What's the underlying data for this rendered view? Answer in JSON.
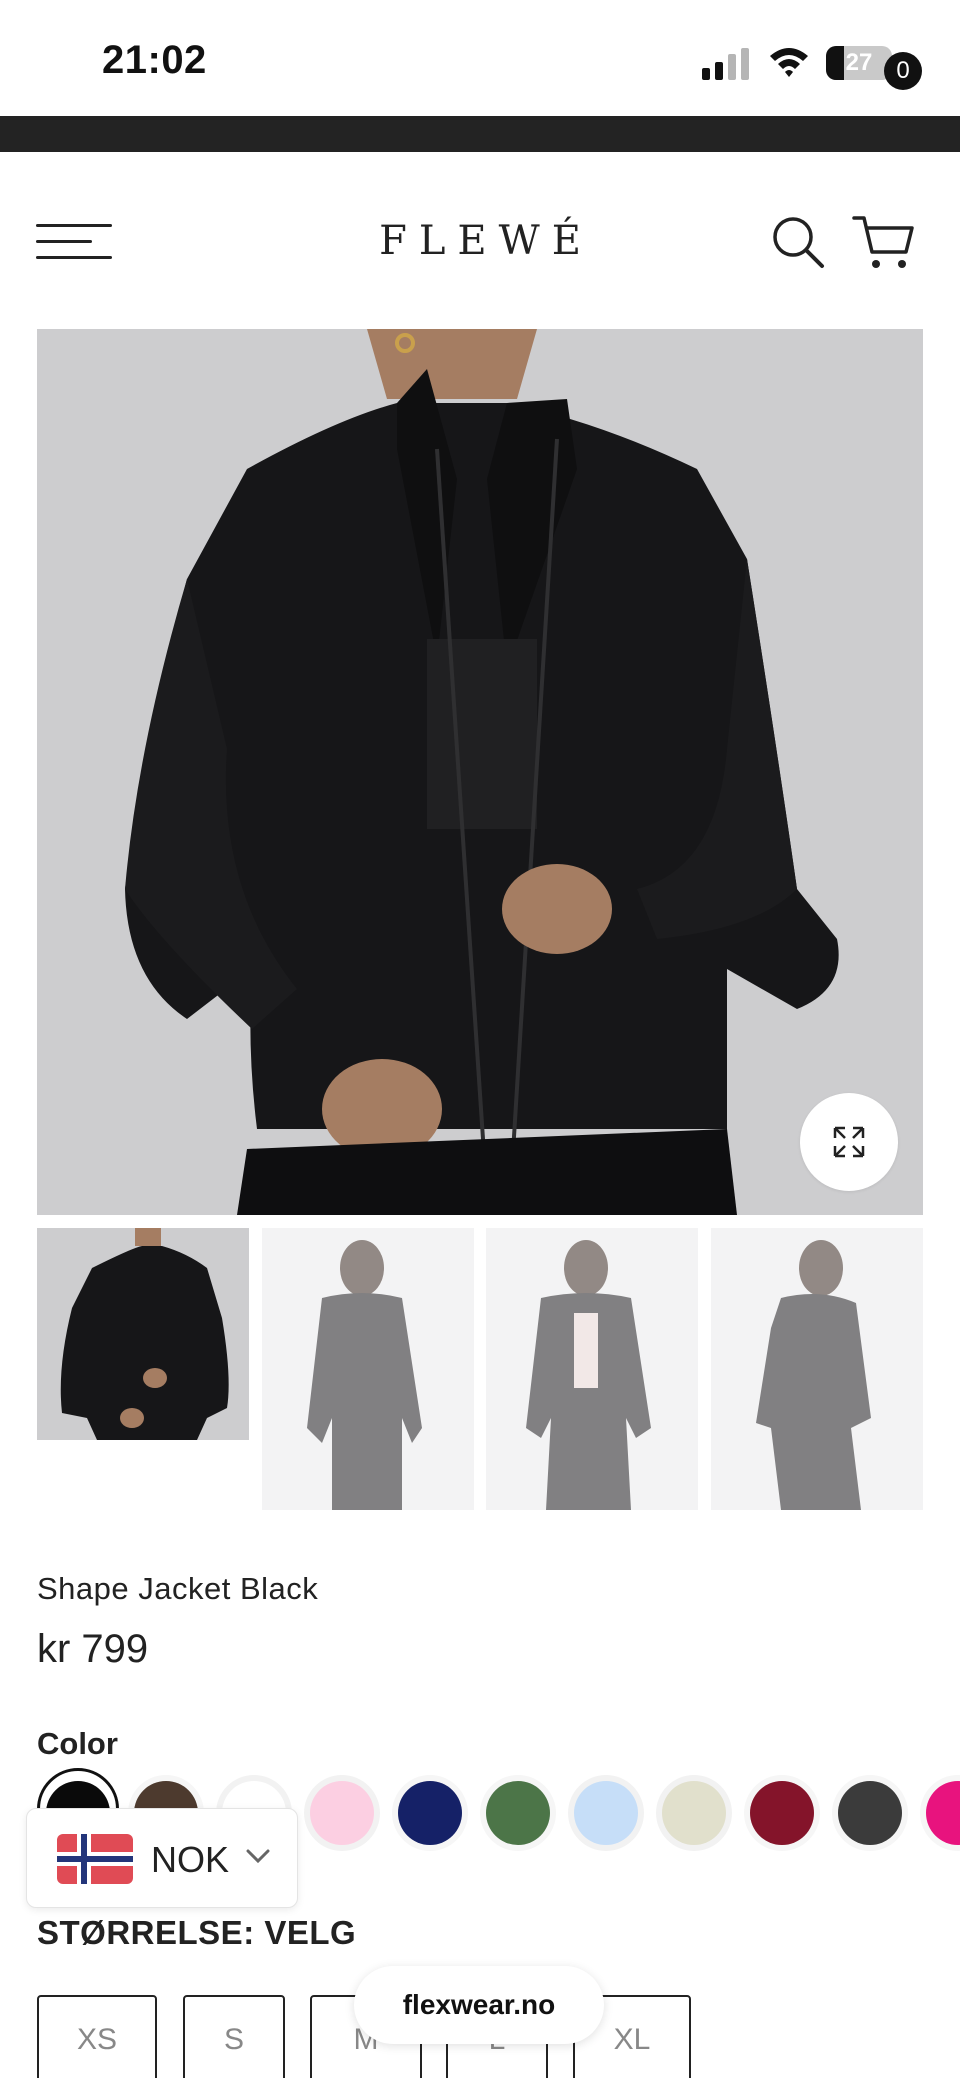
{
  "status_bar": {
    "time": "21:02",
    "battery_level": "27",
    "battery_fraction": 0.27
  },
  "header": {
    "logo": "FLEWÉ",
    "cart_count": "0",
    "icons": [
      "menu-icon",
      "search-icon",
      "cart-icon"
    ]
  },
  "gallery": {
    "main_image_alt": "Shape Jacket Black",
    "zoom_icon": "expand-icon",
    "thumbnail_count": 4,
    "selected_thumbnail": 1
  },
  "product": {
    "title": "Shape Jacket Black",
    "price": "kr 799"
  },
  "color": {
    "label": "Color",
    "selected_index": 0,
    "swatches": [
      "#0a0a0a",
      "#4d3a2e",
      "#ffffff",
      "#fccfe2",
      "#152167",
      "#4c7548",
      "#c6def8",
      "#e1e0cc",
      "#84142a",
      "#3b3b3b",
      "#e8137e"
    ]
  },
  "currency": {
    "code": "NOK",
    "flag": "norway-flag-icon"
  },
  "size": {
    "label": "STØRRELSE: VELG",
    "options": [
      "XS",
      "S",
      "M",
      "L",
      "XL"
    ]
  },
  "browser": {
    "domain": "flexwear.no"
  }
}
